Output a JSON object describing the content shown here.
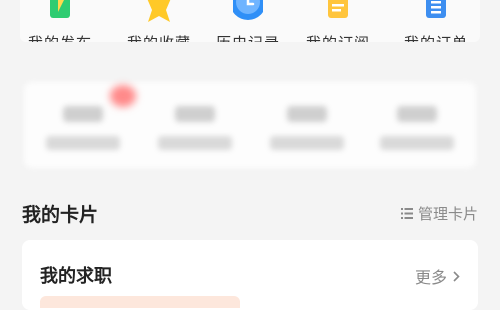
{
  "shortcuts": [
    {
      "label": "我的发布",
      "icon": "pencil-icon",
      "color": "#2ecc71"
    },
    {
      "label": "我的收藏",
      "icon": "star-icon",
      "color": "#ffc928"
    },
    {
      "label": "历史记录",
      "icon": "clock-icon",
      "color": "#2f8ff7"
    },
    {
      "label": "我的订阅",
      "icon": "document-icon",
      "color": "#ffc53d"
    },
    {
      "label": "我的订单",
      "icon": "list-icon",
      "color": "#3d8ef0"
    }
  ],
  "cards_section": {
    "title": "我的卡片",
    "manage_label": "管理卡片"
  },
  "job_card": {
    "title": "我的求职",
    "more_label": "更多"
  }
}
